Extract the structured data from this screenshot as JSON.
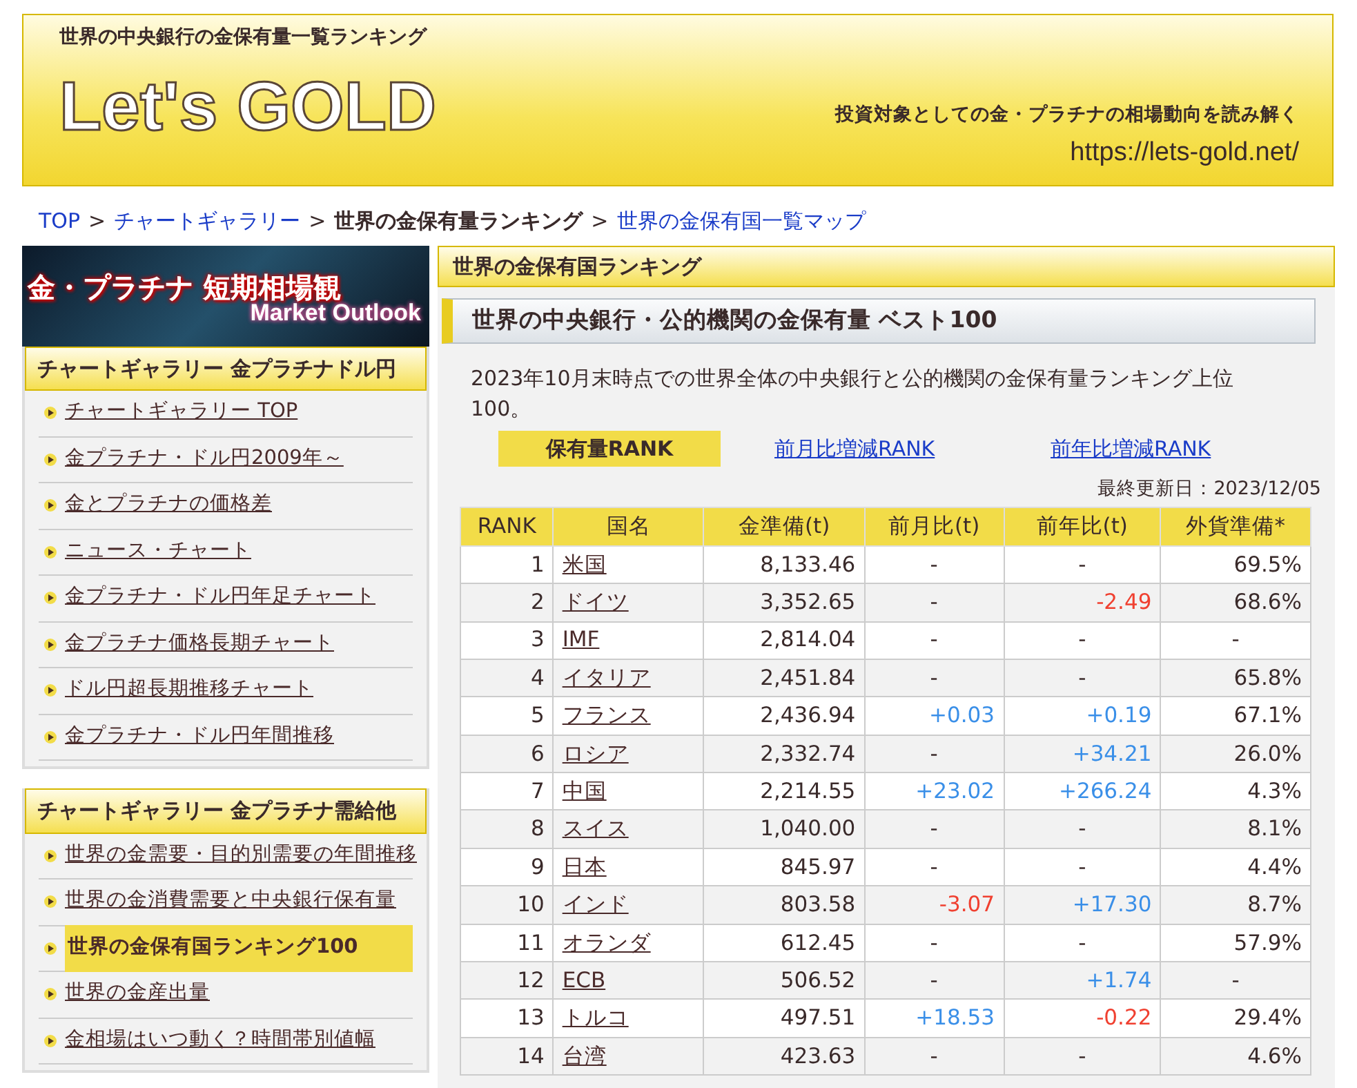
{
  "header": {
    "tagline": "世界の中央銀行の金保有量一覧ランキング",
    "logo": "Let's GOLD",
    "subtitle": "投資対象としての金・プラチナの相場動向を読み解く",
    "url": "https://lets-gold.net/"
  },
  "breadcrumb": [
    {
      "text": "TOP",
      "kind": "link"
    },
    {
      "text": ">",
      "kind": "separator"
    },
    {
      "text": "チャートギャラリー",
      "kind": "link"
    },
    {
      "text": ">",
      "kind": "separator"
    },
    {
      "text": "世界の金保有量ランキング",
      "kind": "current"
    },
    {
      "text": ">",
      "kind": "separator"
    },
    {
      "text": "世界の金保有国一覧マップ",
      "kind": "link"
    }
  ],
  "sidebar": {
    "banner": {
      "title": "金・プラチナ 短期相場観",
      "subtitle": "Market Outlook"
    },
    "sections": [
      {
        "title": "チャートギャラリー 金プラチナドル円",
        "items": [
          {
            "label": "チャートギャラリー TOP",
            "selected": false
          },
          {
            "label": "金プラチナ・ドル円2009年～",
            "selected": false
          },
          {
            "label": "金とプラチナの価格差",
            "selected": false
          },
          {
            "label": "ニュース・チャート",
            "selected": false
          },
          {
            "label": "金プラチナ・ドル円年足チャート",
            "selected": false
          },
          {
            "label": "金プラチナ価格長期チャート",
            "selected": false
          },
          {
            "label": "ドル円超長期推移チャート",
            "selected": false
          },
          {
            "label": "金プラチナ・ドル円年間推移",
            "selected": false
          }
        ]
      },
      {
        "title": "チャートギャラリー 金プラチナ需給他",
        "items": [
          {
            "label": "世界の金需要・目的別需要の年間推移",
            "selected": false
          },
          {
            "label": "世界の金消費需要と中央銀行保有量",
            "selected": false
          },
          {
            "label": "世界の金保有国ランキング100",
            "selected": true
          },
          {
            "label": "世界の金産出量",
            "selected": false
          },
          {
            "label": "金相場はいつ動く？時間帯別値幅",
            "selected": false
          }
        ]
      }
    ]
  },
  "main": {
    "section_title": "世界の金保有国ランキング",
    "heading": "世界の中央銀行・公的機関の金保有量 ベスト100",
    "description": "2023年10月末時点での世界全体の中央銀行と公的機関の金保有量ランキング上位100。",
    "tabs": [
      {
        "label": "保有量RANK",
        "selected": true
      },
      {
        "label": "前月比増減RANK",
        "selected": false
      },
      {
        "label": "前年比増減RANK",
        "selected": false
      }
    ],
    "updated": "最終更新日：2023/12/05",
    "table": {
      "columns": [
        "RANK",
        "国名",
        "金準備(t)",
        "前月比(t)",
        "前年比(t)",
        "外貨準備*"
      ],
      "rows": [
        {
          "rank": "1",
          "country": "米国",
          "reserve": "8,133.46",
          "month": {
            "text": "-",
            "color": "#3a2a2a"
          },
          "year": {
            "text": "-",
            "color": "#3a2a2a"
          },
          "fx": "69.5%"
        },
        {
          "rank": "2",
          "country": "ドイツ",
          "reserve": "3,352.65",
          "month": {
            "text": "-",
            "color": "#3a2a2a"
          },
          "year": {
            "text": "-2.49",
            "color": "#f04030"
          },
          "fx": "68.6%"
        },
        {
          "rank": "3",
          "country": "IMF",
          "reserve": "2,814.04",
          "month": {
            "text": "-",
            "color": "#3a2a2a"
          },
          "year": {
            "text": "-",
            "color": "#3a2a2a"
          },
          "fx": "-"
        },
        {
          "rank": "4",
          "country": "イタリア",
          "reserve": "2,451.84",
          "month": {
            "text": "-",
            "color": "#3a2a2a"
          },
          "year": {
            "text": "-",
            "color": "#3a2a2a"
          },
          "fx": "65.8%"
        },
        {
          "rank": "5",
          "country": "フランス",
          "reserve": "2,436.94",
          "month": {
            "text": "+0.03",
            "color": "#3a8fe8"
          },
          "year": {
            "text": "+0.19",
            "color": "#3a8fe8"
          },
          "fx": "67.1%"
        },
        {
          "rank": "6",
          "country": "ロシア",
          "reserve": "2,332.74",
          "month": {
            "text": "-",
            "color": "#3a2a2a"
          },
          "year": {
            "text": "+34.21",
            "color": "#3a8fe8"
          },
          "fx": "26.0%"
        },
        {
          "rank": "7",
          "country": "中国",
          "reserve": "2,214.55",
          "month": {
            "text": "+23.02",
            "color": "#3a8fe8"
          },
          "year": {
            "text": "+266.24",
            "color": "#3a8fe8"
          },
          "fx": "4.3%"
        },
        {
          "rank": "8",
          "country": "スイス",
          "reserve": "1,040.00",
          "month": {
            "text": "-",
            "color": "#3a2a2a"
          },
          "year": {
            "text": "-",
            "color": "#3a2a2a"
          },
          "fx": "8.1%"
        },
        {
          "rank": "9",
          "country": "日本",
          "reserve": "845.97",
          "month": {
            "text": "-",
            "color": "#3a2a2a"
          },
          "year": {
            "text": "-",
            "color": "#3a2a2a"
          },
          "fx": "4.4%"
        },
        {
          "rank": "10",
          "country": "インド",
          "reserve": "803.58",
          "month": {
            "text": "-3.07",
            "color": "#f04030"
          },
          "year": {
            "text": "+17.30",
            "color": "#3a8fe8"
          },
          "fx": "8.7%"
        },
        {
          "rank": "11",
          "country": "オランダ",
          "reserve": "612.45",
          "month": {
            "text": "-",
            "color": "#3a2a2a"
          },
          "year": {
            "text": "-",
            "color": "#3a2a2a"
          },
          "fx": "57.9%"
        },
        {
          "rank": "12",
          "country": "ECB",
          "reserve": "506.52",
          "month": {
            "text": "-",
            "color": "#3a2a2a"
          },
          "year": {
            "text": "+1.74",
            "color": "#3a8fe8"
          },
          "fx": "-"
        },
        {
          "rank": "13",
          "country": "トルコ",
          "reserve": "497.51",
          "month": {
            "text": "+18.53",
            "color": "#3a8fe8"
          },
          "year": {
            "text": "-0.22",
            "color": "#f04030"
          },
          "fx": "29.4%"
        },
        {
          "rank": "14",
          "country": "台湾",
          "reserve": "423.63",
          "month": {
            "text": "-",
            "color": "#3a2a2a"
          },
          "year": {
            "text": "-",
            "color": "#3a2a2a"
          },
          "fx": "4.6%"
        }
      ]
    }
  }
}
